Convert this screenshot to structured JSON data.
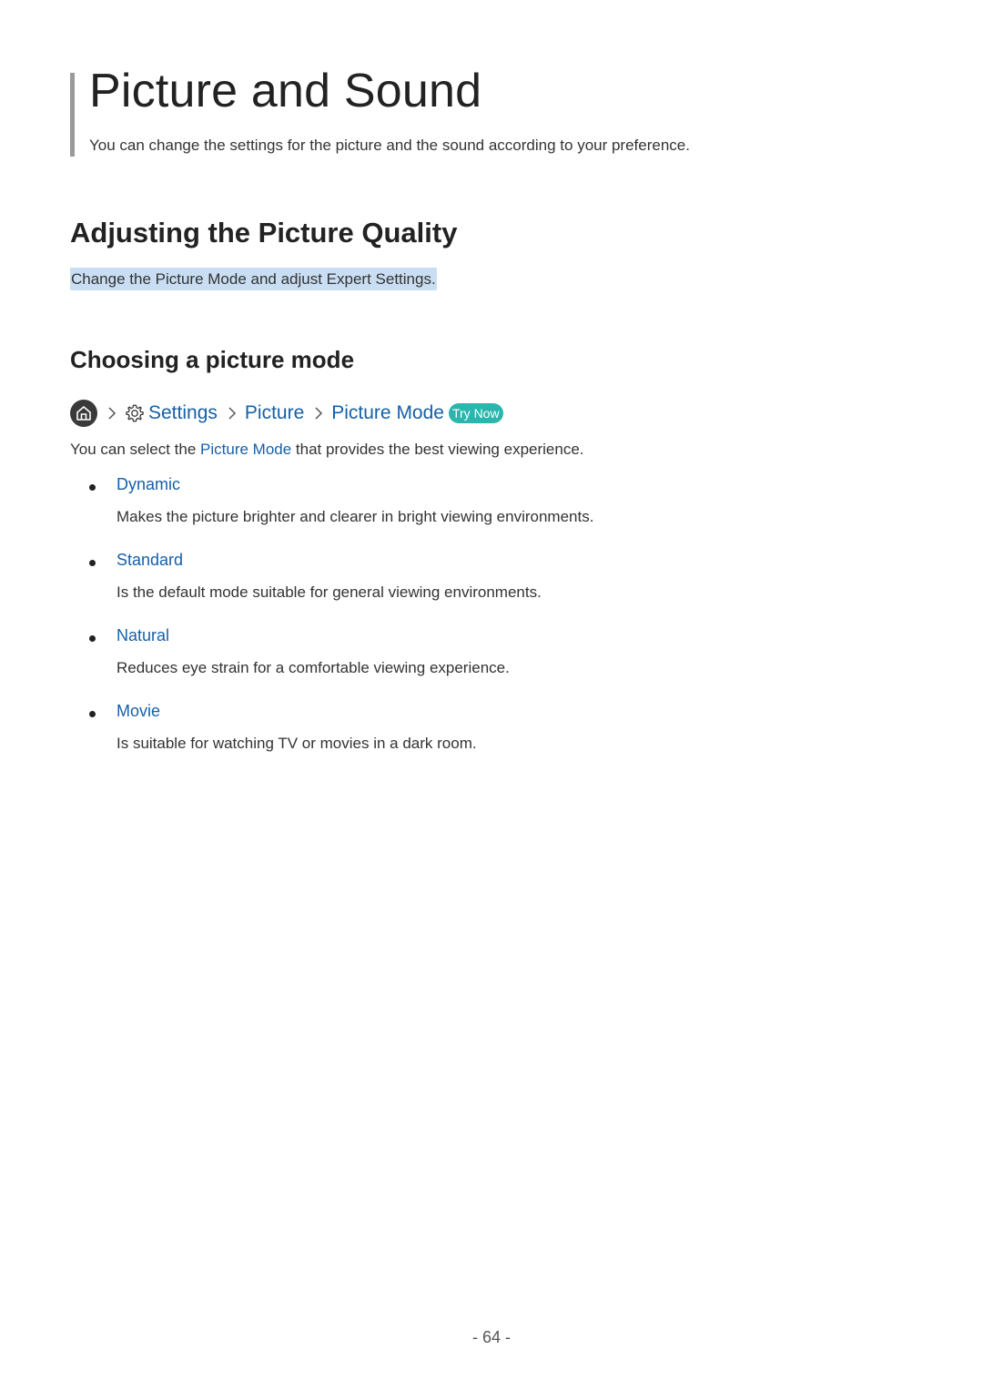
{
  "chapter": {
    "title": "Picture and Sound",
    "intro": "You can change the settings for the picture and the sound according to your preference."
  },
  "section": {
    "title": "Adjusting the Picture Quality",
    "summary": "Change the Picture Mode and adjust Expert Settings."
  },
  "subsection": {
    "title": "Choosing a picture mode"
  },
  "nav_path": {
    "icons": [
      "home-icon",
      "chevron-right-icon",
      "gear-icon"
    ],
    "items": [
      "Settings",
      "Picture",
      "Picture Mode"
    ],
    "try_now": "Try Now"
  },
  "body": {
    "prefix": "You can select the ",
    "link": "Picture Mode",
    "suffix": " that provides the best viewing experience."
  },
  "modes": [
    {
      "name": "Dynamic",
      "description": "Makes the picture brighter and clearer in bright viewing environments."
    },
    {
      "name": "Standard",
      "description": "Is the default mode suitable for general viewing environments."
    },
    {
      "name": "Natural",
      "description": "Reduces eye strain for a comfortable viewing experience."
    },
    {
      "name": "Movie",
      "description": "Is suitable for watching TV or movies in a dark room."
    }
  ],
  "page_number": "- 64 -",
  "colors": {
    "link": "#1560a8",
    "highlight": "#c9def2",
    "try_now_badge": "#2bb5ad",
    "chapter_bar": "#9a9a9a"
  }
}
